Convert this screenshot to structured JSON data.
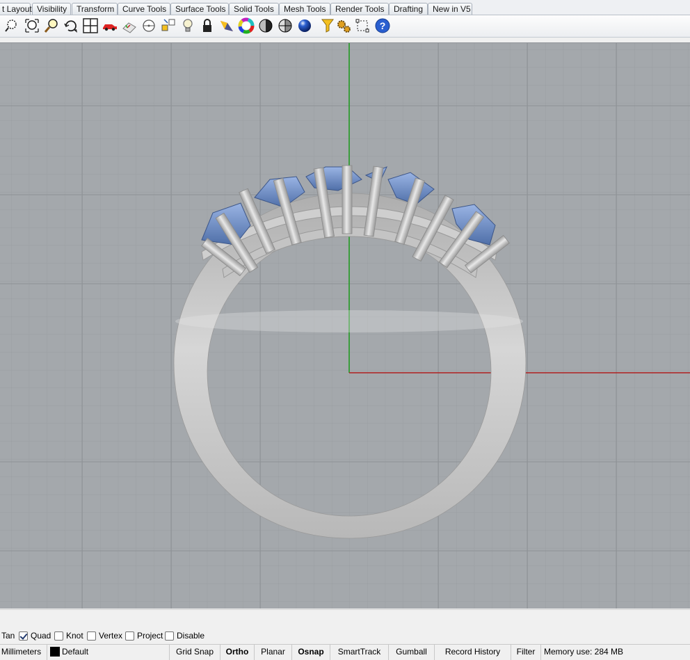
{
  "tabs": [
    {
      "label": "t Layout"
    },
    {
      "label": "Visibility"
    },
    {
      "label": "Transform"
    },
    {
      "label": "Curve Tools"
    },
    {
      "label": "Surface Tools"
    },
    {
      "label": "Solid Tools"
    },
    {
      "label": "Mesh Tools"
    },
    {
      "label": "Render Tools"
    },
    {
      "label": "Drafting"
    },
    {
      "label": "New in V5"
    }
  ],
  "toolbar": {
    "icons": [
      "zoom-dynamic-icon",
      "zoom-extents-icon",
      "zoom-window-icon",
      "rotate-view-icon",
      "four-viewports-icon",
      "named-view-car-icon",
      "cplane-icon",
      "options-icon",
      "select-icon",
      "lightbulb-icon",
      "lock-icon",
      "material-icon",
      "color-wheel-icon",
      "shaded-icon",
      "ghosted-icon",
      "rendered-sphere-icon",
      "filter-icon",
      "settings-gears-icon",
      "dimension-icon",
      "help-icon"
    ]
  },
  "osnap": {
    "items": [
      {
        "label": "Tan",
        "checked": null
      },
      {
        "label": "Quad",
        "checked": true
      },
      {
        "label": "Knot",
        "checked": false
      },
      {
        "label": "Vertex",
        "checked": false
      },
      {
        "label": "Project",
        "checked": false
      },
      {
        "label": "Disable",
        "checked": false
      }
    ]
  },
  "status": {
    "units": "Millimeters",
    "layer": "Default",
    "layer_color": "#000000",
    "grid_snap": "Grid Snap",
    "ortho": "Ortho",
    "planar": "Planar",
    "osnap": "Osnap",
    "smarttrack": "SmartTrack",
    "gumball": "Gumball",
    "record_history": "Record History",
    "filter": "Filter",
    "memory": "Memory use: 284 MB"
  },
  "colors": {
    "viewport_bg": "#a4a8ac",
    "x_axis": "#b02020",
    "y_axis": "#1a9a1a",
    "gem": "#6f8fc8",
    "metal": "#c8c8c8"
  }
}
